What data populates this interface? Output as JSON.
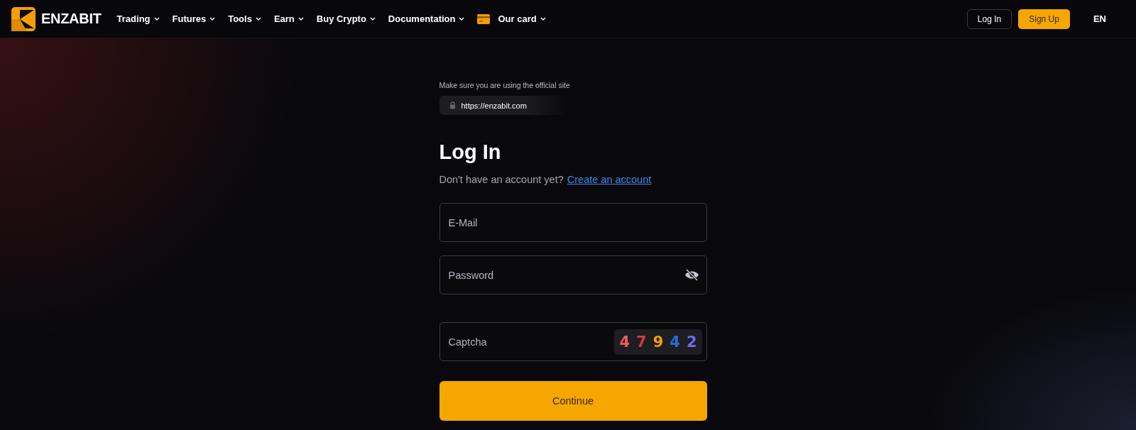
{
  "brand": {
    "name": "ENZABIT"
  },
  "nav": [
    {
      "label": "Trading",
      "icon": false
    },
    {
      "label": "Futures",
      "icon": false
    },
    {
      "label": "Tools",
      "icon": false
    },
    {
      "label": "Earn",
      "icon": false
    },
    {
      "label": "Buy Crypto",
      "icon": false
    },
    {
      "label": "Documentation",
      "icon": false
    },
    {
      "label": "Our card",
      "icon": true
    }
  ],
  "header_actions": {
    "login": "Log In",
    "signup": "Sign Up",
    "language": "EN"
  },
  "notice": {
    "text": "Make sure you are using the official site",
    "url": "https://enzabit.com"
  },
  "form": {
    "title": "Log In",
    "prompt": "Don't have an account yet?",
    "link": "Create an account",
    "fields": [
      {
        "kind": "text",
        "placeholder": "E-Mail"
      },
      {
        "kind": "password",
        "placeholder": "Password"
      },
      {
        "kind": "captcha",
        "placeholder": "Captcha"
      }
    ],
    "captcha": [
      {
        "digit": "4",
        "color": "#f05a5a"
      },
      {
        "digit": "7",
        "color": "#d63a3a"
      },
      {
        "digit": "9",
        "color": "#f5a000"
      },
      {
        "digit": "4",
        "color": "#1e6fd9"
      },
      {
        "digit": "2",
        "color": "#6b6bf0"
      }
    ],
    "submit": "Continue"
  }
}
